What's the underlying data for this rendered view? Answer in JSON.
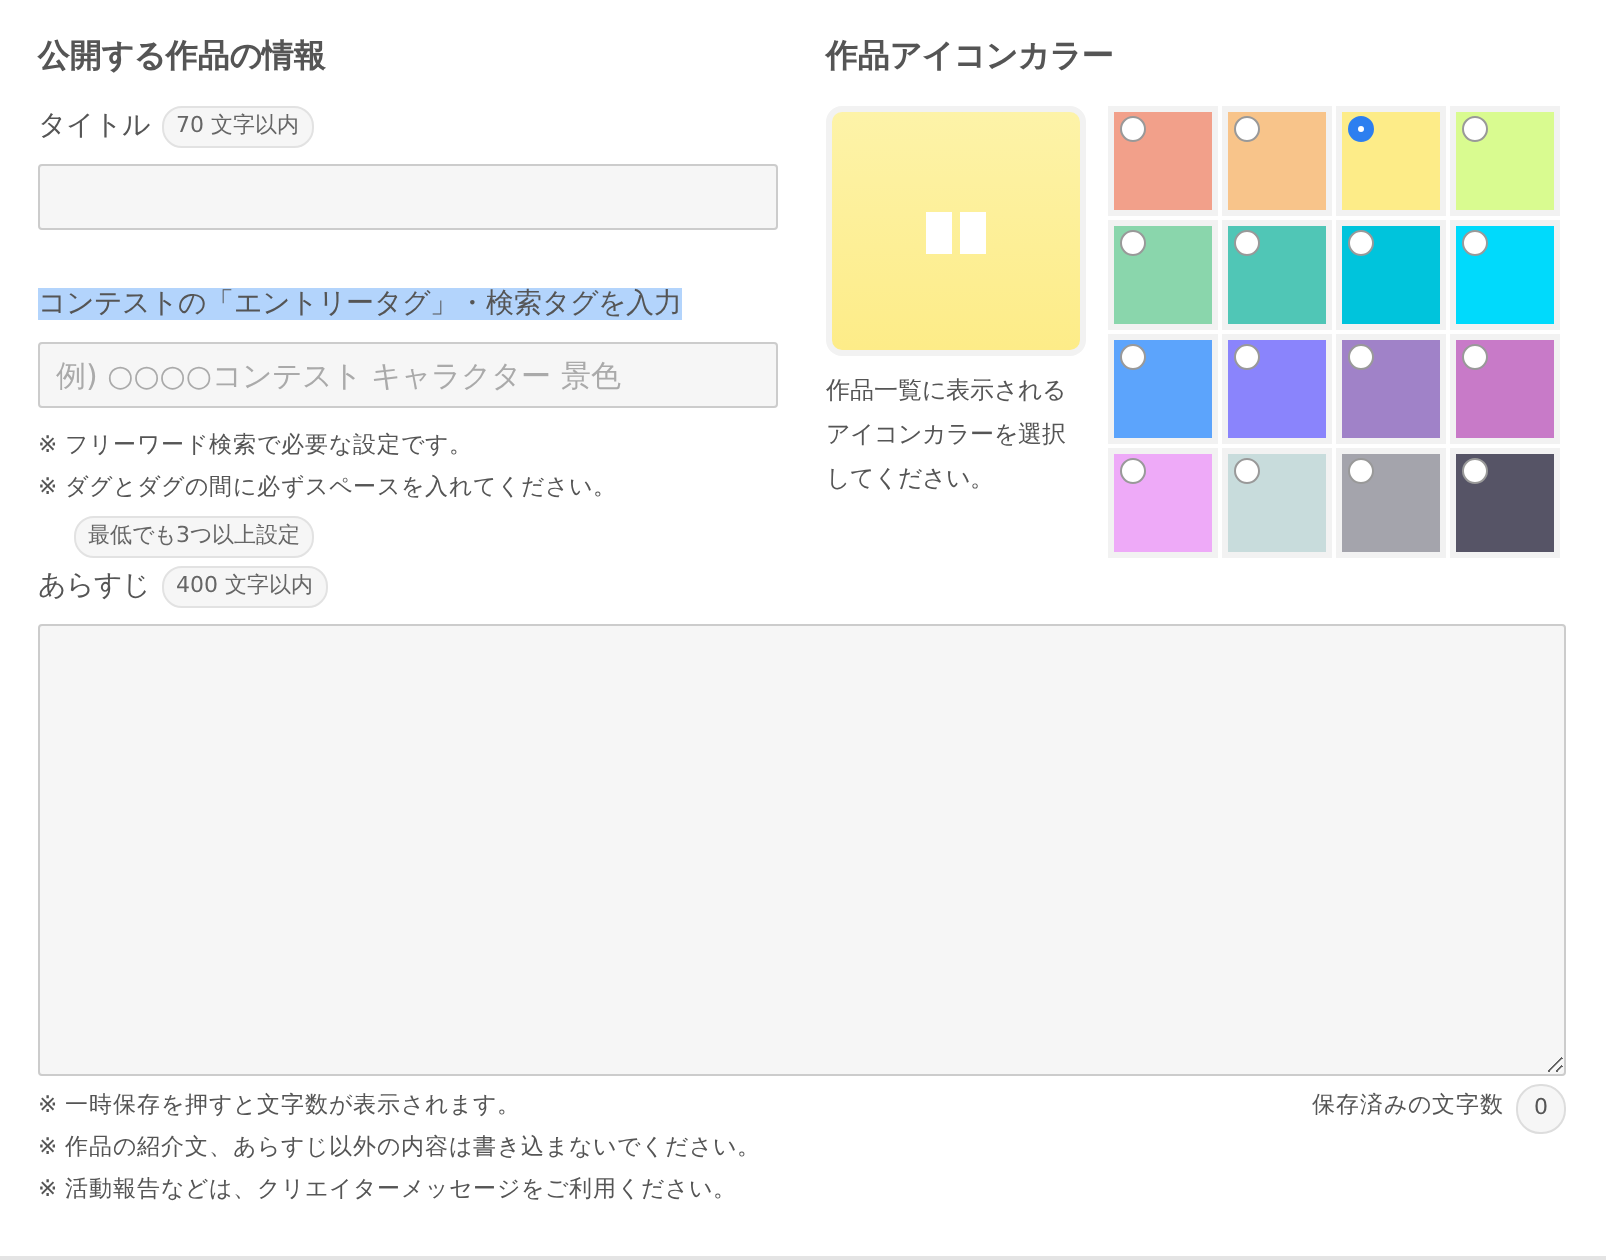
{
  "info": {
    "heading": "公開する作品の情報",
    "title_field": {
      "label": "タイトル",
      "limit": "70 文字以内"
    },
    "tag_field": {
      "label": "コンテストの「エントリータグ」・検索タグを入力",
      "highlighted": true,
      "placeholder": "例) ○○○○コンテスト キャラクター 景色"
    },
    "tag_notes": [
      "※ フリーワード検索で必要な設定です。",
      "※ ダグとダグの間に必ずスペースを入れてください。"
    ],
    "tag_badge": "最低でも3つ以上設定"
  },
  "icon_color": {
    "heading": "作品アイコンカラー",
    "description": "作品一覧に表示されるアイコンカラーを選択してください。",
    "swatches": [
      {
        "color": "#f2a08a",
        "selected": false
      },
      {
        "color": "#f8c48a",
        "selected": false
      },
      {
        "color": "#fdec88",
        "selected": true
      },
      {
        "color": "#d9fb90",
        "selected": false
      },
      {
        "color": "#8ad6ac",
        "selected": false
      },
      {
        "color": "#50c6b6",
        "selected": false
      },
      {
        "color": "#00c4dc",
        "selected": false
      },
      {
        "color": "#00dafc",
        "selected": false
      },
      {
        "color": "#5ca4fc",
        "selected": false
      },
      {
        "color": "#8a84fc",
        "selected": false
      },
      {
        "color": "#a082c8",
        "selected": false
      },
      {
        "color": "#c87ac8",
        "selected": false
      },
      {
        "color": "#eeaaf8",
        "selected": false
      },
      {
        "color": "#c8dcdc",
        "selected": false
      },
      {
        "color": "#a4a4ac",
        "selected": false
      },
      {
        "color": "#565466",
        "selected": false
      }
    ]
  },
  "synopsis": {
    "label": "あらすじ",
    "limit": "400 文字以内",
    "notes": [
      "※ 一時保存を押すと文字数が表示されます。",
      "※ 作品の紹介文、あらすじ以外の内容は書き込まないでください。",
      "※ 活動報告などは、クリエイターメッセージをご利用ください。"
    ],
    "saved_label": "保存済みの文字数",
    "saved_count": "0"
  }
}
